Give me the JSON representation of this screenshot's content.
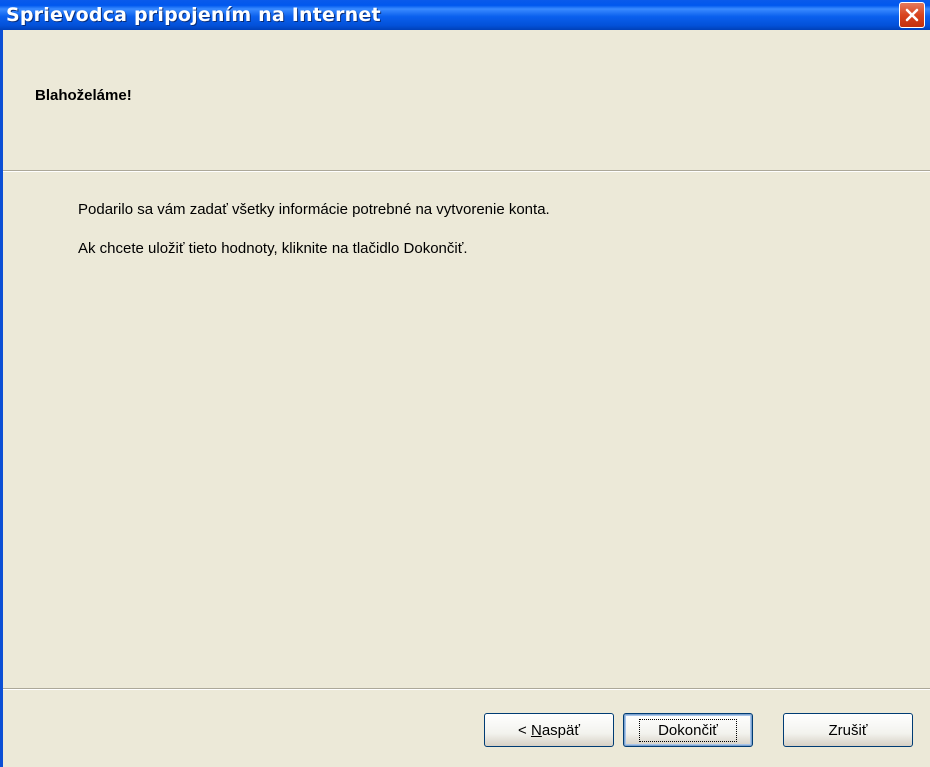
{
  "window": {
    "title": "Sprievodca pripojením na Internet"
  },
  "header": {
    "title": "Blahoželáme!"
  },
  "content": {
    "line1": "Podarilo sa vám zadať všetky informácie potrebné na vytvorenie konta.",
    "line2": "Ak chcete uložiť tieto hodnoty, kliknite na tlačidlo Dokončiť."
  },
  "buttons": {
    "back_prefix": "< ",
    "back_accel": "N",
    "back_rest": "aspäť",
    "finish": "Dokončiť",
    "cancel": "Zrušiť"
  },
  "icons": {
    "close": "close-icon"
  },
  "colors": {
    "titlebar": "#0058EE",
    "close_button": "#D9451E",
    "dialog_background": "#ECE9D8"
  }
}
